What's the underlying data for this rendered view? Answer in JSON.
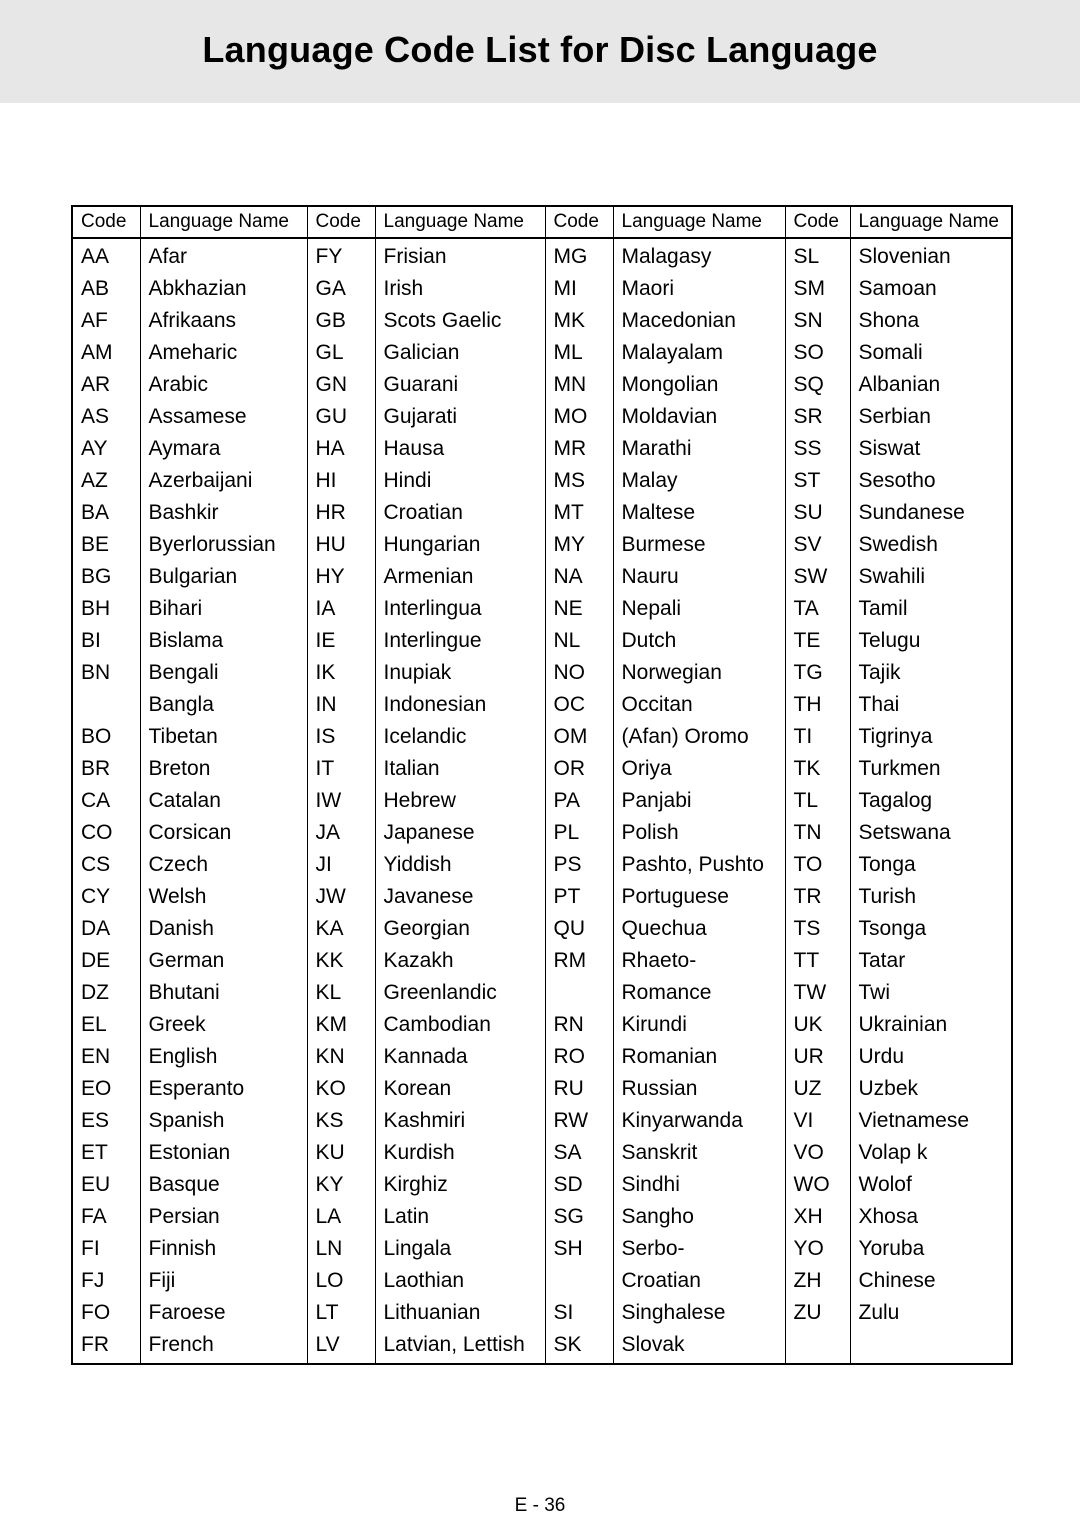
{
  "page": {
    "title": "Language Code List for Disc Language",
    "footer": "E - 36",
    "band_color": "#e7e7e7",
    "text_color": "#000000",
    "background_color": "#ffffff"
  },
  "table": {
    "headers": [
      "Code",
      "Language Name",
      "Code",
      "Language Name",
      "Code",
      "Language Name",
      "Code",
      "Language Name"
    ],
    "rows": [
      [
        "AA",
        "Afar",
        "FY",
        "Frisian",
        "MG",
        "Malagasy",
        "SL",
        "Slovenian"
      ],
      [
        "AB",
        "Abkhazian",
        "GA",
        "Irish",
        "MI",
        "Maori",
        "SM",
        "Samoan"
      ],
      [
        "AF",
        "Afrikaans",
        "GB",
        "Scots Gaelic",
        "MK",
        "Macedonian",
        "SN",
        "Shona"
      ],
      [
        "AM",
        "Ameharic",
        "GL",
        "Galician",
        "ML",
        "Malayalam",
        "SO",
        "Somali"
      ],
      [
        "AR",
        "Arabic",
        "GN",
        "Guarani",
        "MN",
        "Mongolian",
        "SQ",
        "Albanian"
      ],
      [
        "AS",
        "Assamese",
        "GU",
        "Gujarati",
        "MO",
        "Moldavian",
        "SR",
        "Serbian"
      ],
      [
        "AY",
        "Aymara",
        "HA",
        "Hausa",
        "MR",
        "Marathi",
        "SS",
        "Siswat"
      ],
      [
        "AZ",
        "Azerbaijani",
        "HI",
        "Hindi",
        "MS",
        "Malay",
        "ST",
        "Sesotho"
      ],
      [
        "BA",
        "Bashkir",
        "HR",
        "Croatian",
        "MT",
        "Maltese",
        "SU",
        "Sundanese"
      ],
      [
        "BE",
        "Byerlorussian",
        "HU",
        "Hungarian",
        "MY",
        "Burmese",
        "SV",
        "Swedish"
      ],
      [
        "BG",
        "Bulgarian",
        "HY",
        "Armenian",
        "NA",
        "Nauru",
        "SW",
        "Swahili"
      ],
      [
        "BH",
        "Bihari",
        "IA",
        "Interlingua",
        "NE",
        "Nepali",
        "TA",
        "Tamil"
      ],
      [
        "BI",
        "Bislama",
        "IE",
        "Interlingue",
        "NL",
        "Dutch",
        "TE",
        "Telugu"
      ],
      [
        "BN",
        "Bengali",
        "IK",
        "Inupiak",
        "NO",
        "Norwegian",
        "TG",
        "Tajik"
      ],
      [
        "",
        "Bangla",
        "IN",
        "Indonesian",
        "OC",
        "Occitan",
        "TH",
        "Thai"
      ],
      [
        "BO",
        "Tibetan",
        "IS",
        "Icelandic",
        "OM",
        "(Afan) Oromo",
        "TI",
        "Tigrinya"
      ],
      [
        "BR",
        "Breton",
        "IT",
        "Italian",
        "OR",
        "Oriya",
        "TK",
        "Turkmen"
      ],
      [
        "CA",
        "Catalan",
        "IW",
        "Hebrew",
        "PA",
        "Panjabi",
        "TL",
        "Tagalog"
      ],
      [
        "CO",
        "Corsican",
        "JA",
        "Japanese",
        "PL",
        "Polish",
        "TN",
        "Setswana"
      ],
      [
        "CS",
        "Czech",
        "JI",
        "Yiddish",
        "PS",
        "Pashto, Pushto",
        "TO",
        "Tonga"
      ],
      [
        "CY",
        "Welsh",
        "JW",
        "Javanese",
        "PT",
        "Portuguese",
        "TR",
        "Turish"
      ],
      [
        "DA",
        "Danish",
        "KA",
        "Georgian",
        "QU",
        "Quechua",
        "TS",
        "Tsonga"
      ],
      [
        "DE",
        "German",
        "KK",
        "Kazakh",
        "RM",
        "Rhaeto-",
        "TT",
        "Tatar"
      ],
      [
        "DZ",
        "Bhutani",
        "KL",
        "Greenlandic",
        "",
        "Romance",
        "TW",
        "Twi"
      ],
      [
        "EL",
        "Greek",
        "KM",
        "Cambodian",
        "RN",
        "Kirundi",
        "UK",
        "Ukrainian"
      ],
      [
        "EN",
        "English",
        "KN",
        "Kannada",
        "RO",
        "Romanian",
        "UR",
        "Urdu"
      ],
      [
        "EO",
        "Esperanto",
        "KO",
        "Korean",
        "RU",
        "Russian",
        "UZ",
        "Uzbek"
      ],
      [
        "ES",
        "Spanish",
        "KS",
        "Kashmiri",
        "RW",
        "Kinyarwanda",
        "VI",
        "Vietnamese"
      ],
      [
        "ET",
        "Estonian",
        "KU",
        "Kurdish",
        "SA",
        "Sanskrit",
        "VO",
        "Volap k"
      ],
      [
        "EU",
        "Basque",
        "KY",
        "Kirghiz",
        "SD",
        "Sindhi",
        "WO",
        "Wolof"
      ],
      [
        "FA",
        "Persian",
        "LA",
        "Latin",
        "SG",
        "Sangho",
        "XH",
        "Xhosa"
      ],
      [
        "FI",
        "Finnish",
        "LN",
        "Lingala",
        "SH",
        "Serbo-",
        "YO",
        "Yoruba"
      ],
      [
        "FJ",
        "Fiji",
        "LO",
        "Laothian",
        "",
        "Croatian",
        "ZH",
        "Chinese"
      ],
      [
        "FO",
        "Faroese",
        "LT",
        "Lithuanian",
        "SI",
        "Singhalese",
        "ZU",
        "Zulu"
      ],
      [
        "FR",
        "French",
        "LV",
        "Latvian, Lettish",
        "SK",
        "Slovak",
        "",
        ""
      ]
    ]
  }
}
